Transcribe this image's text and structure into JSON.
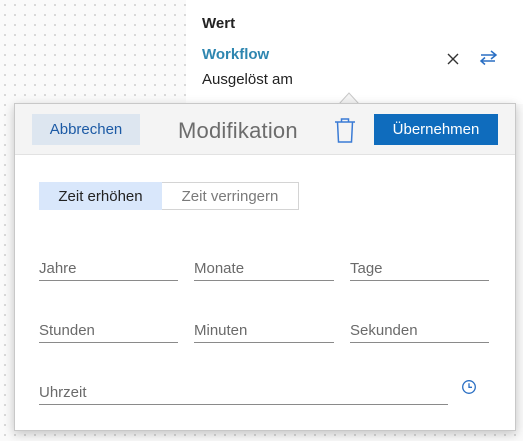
{
  "value_card": {
    "heading": "Wert",
    "token_label": "Workflow",
    "token_sublabel": "Ausgelöst am",
    "close_icon": "close-icon",
    "swap_icon": "swap-icon"
  },
  "popover": {
    "cancel_label": "Abbrechen",
    "title": "Modifikation",
    "delete_icon": "trash-icon",
    "apply_label": "Übernehmen",
    "toggle": {
      "increase_label": "Zeit erhöhen",
      "decrease_label": "Zeit verringern",
      "selected": "Zeit erhöhen"
    },
    "fields": {
      "years": {
        "placeholder": "Jahre",
        "value": ""
      },
      "months": {
        "placeholder": "Monate",
        "value": ""
      },
      "days": {
        "placeholder": "Tage",
        "value": ""
      },
      "hours": {
        "placeholder": "Stunden",
        "value": ""
      },
      "minutes": {
        "placeholder": "Minuten",
        "value": ""
      },
      "seconds": {
        "placeholder": "Sekunden",
        "value": ""
      },
      "time": {
        "placeholder": "Uhrzeit",
        "value": ""
      }
    },
    "clock_icon": "clock-icon"
  },
  "colors": {
    "accent": "#0f6cbd",
    "token": "#2e86b0",
    "cancel_bg": "#dde6f0",
    "toggle_active_bg": "#d9e7fb"
  }
}
